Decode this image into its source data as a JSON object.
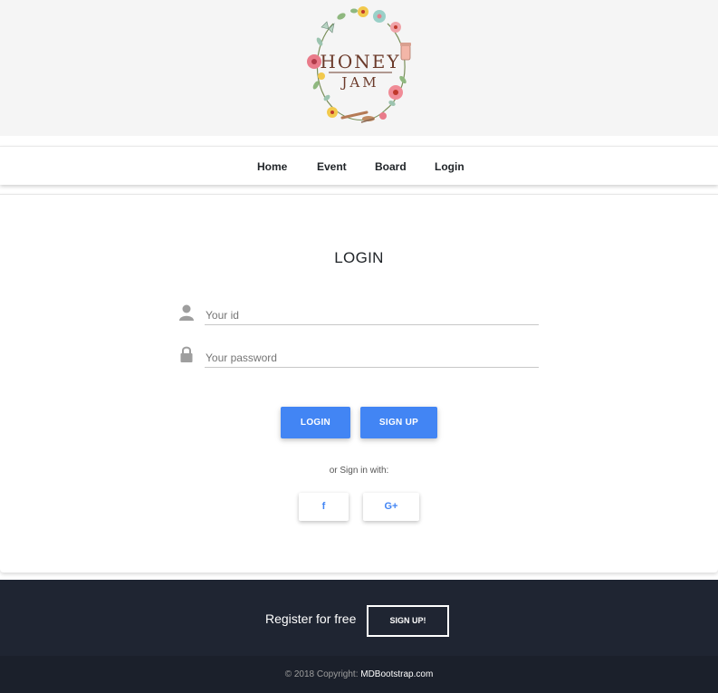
{
  "logo": {
    "line1": "HONEY",
    "line2": "JAM"
  },
  "nav": {
    "items": [
      {
        "label": "Home"
      },
      {
        "label": "Event"
      },
      {
        "label": "Board"
      },
      {
        "label": "Login"
      }
    ]
  },
  "login": {
    "title": "LOGIN",
    "id_field": {
      "placeholder": "Your id",
      "value": "",
      "icon": "user-icon"
    },
    "password_field": {
      "placeholder": "Your password",
      "value": "",
      "icon": "lock-icon"
    },
    "login_button": "LOGIN",
    "signup_button": "SIGN UP",
    "alt_text": "or Sign in with:",
    "social": {
      "facebook": {
        "label": "f",
        "icon": "facebook-icon"
      },
      "google": {
        "label": "G+",
        "icon": "google-plus-icon"
      }
    }
  },
  "footer": {
    "cta_text": "Register for free",
    "cta_button": "SIGN UP!",
    "copyright_prefix": "© 2018 Copyright:",
    "copyright_link": "MDBootstrap.com"
  },
  "colors": {
    "header_bg": "#f5f5f5",
    "primary": "#4285f4",
    "footer_bg": "#1f2532",
    "copyright_bg": "#1b202b"
  }
}
